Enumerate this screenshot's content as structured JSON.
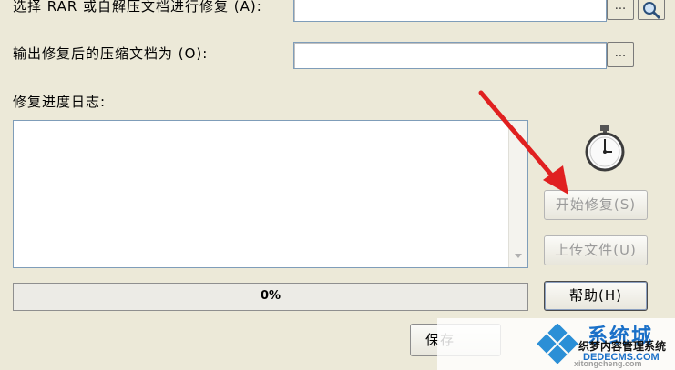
{
  "form": {
    "select_label": "选择 RAR 或自解压文档进行修复 (A):",
    "output_label": "输出修复后的压缩文档为 (O):",
    "browse_label": "...",
    "log_label": "修复进度日志:"
  },
  "progress": {
    "percent_text": "0%",
    "value": 0
  },
  "buttons": {
    "start_repair": "开始修复(S)",
    "upload_file": "上传文件(U)",
    "help": "帮助(H)",
    "save": "保存"
  },
  "watermark": {
    "site_name": "系统城",
    "domain": "xitongcheng.com",
    "brand_cn": "织梦内容管理系统",
    "brand_en": "DEDECMS.COM"
  },
  "colors": {
    "annotation_arrow": "#e02020",
    "dialog_bg": "#ece9d8",
    "watermark_blue": "#1a70c8"
  },
  "icons": [
    "search-magnifier-icon",
    "stopwatch-icon",
    "scroll-down-icon",
    "annotation-arrow",
    "windows-logo-icon"
  ]
}
